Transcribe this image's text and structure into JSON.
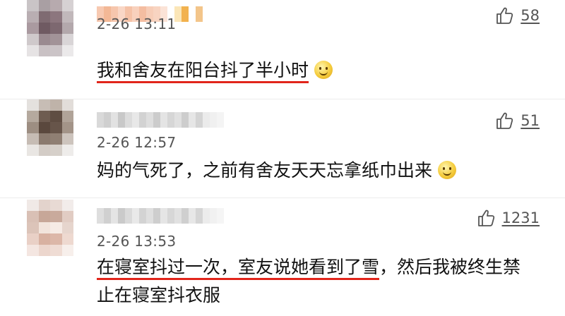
{
  "comments": [
    {
      "time": "2-26 13:11",
      "likes": "58",
      "text_underlined": "我和舍友在阳台抖了半小时",
      "text_rest": "",
      "emoji": "smile-emoji"
    },
    {
      "time": "2-26 12:57",
      "likes": "51",
      "text_underlined": "",
      "text_rest": "妈的气死了，之前有舍友天天忘拿纸巾出来",
      "emoji": "thinking-emoji"
    },
    {
      "time": "2-26 13:53",
      "likes": "1231",
      "text_underlined": "在寝室抖过一次，室友说她看到了雪",
      "text_rest": "，然后我被终生禁止在寝室抖衣服",
      "emoji": ""
    }
  ],
  "icons": {
    "like": "thumbs-up-icon"
  },
  "colors": {
    "underline": "#e1251b",
    "text": "#111111",
    "meta": "#555555"
  }
}
